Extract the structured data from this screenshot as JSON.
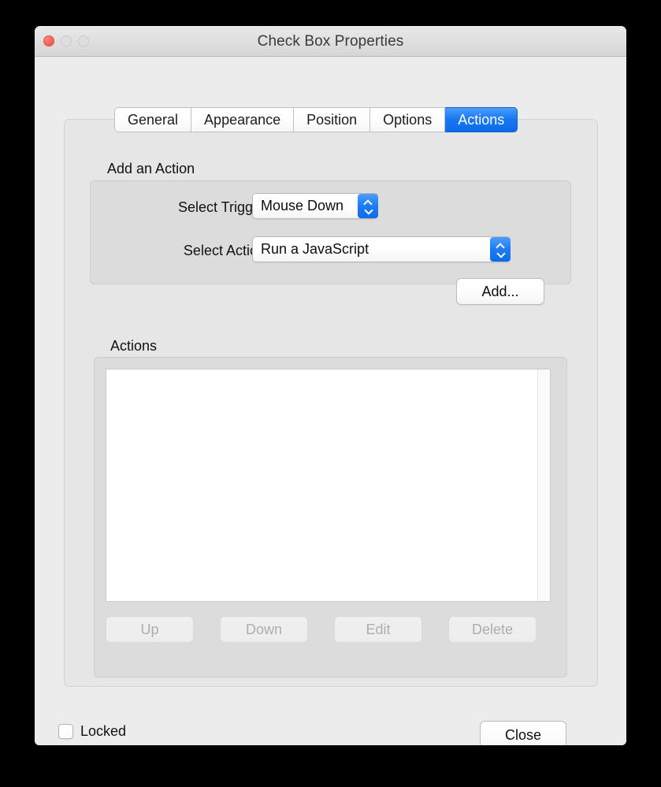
{
  "window": {
    "title": "Check Box Properties",
    "traffic_lights": [
      {
        "name": "close",
        "state": "active"
      },
      {
        "name": "minimize",
        "state": "disabled"
      },
      {
        "name": "zoom",
        "state": "disabled"
      }
    ]
  },
  "tabs": [
    {
      "label": "General",
      "selected": false
    },
    {
      "label": "Appearance",
      "selected": false
    },
    {
      "label": "Position",
      "selected": false
    },
    {
      "label": "Options",
      "selected": false
    },
    {
      "label": "Actions",
      "selected": true
    }
  ],
  "add_action_group": {
    "title": "Add an Action",
    "trigger": {
      "label": "Select Trigger:",
      "value": "Mouse Down"
    },
    "action": {
      "label": "Select Action:",
      "value": "Run a JavaScript"
    },
    "add_button": "Add..."
  },
  "actions_group": {
    "title": "Actions",
    "items": [],
    "buttons": [
      {
        "label": "Up",
        "enabled": false
      },
      {
        "label": "Down",
        "enabled": false
      },
      {
        "label": "Edit",
        "enabled": false
      },
      {
        "label": "Delete",
        "enabled": false
      }
    ]
  },
  "footer": {
    "locked_label": "Locked",
    "locked_checked": false,
    "close_button": "Close"
  },
  "colors": {
    "accent_blue": "#1878f2",
    "close_red": "#fc6258",
    "window_bg": "#ececec",
    "panel_bg": "#e6e6e6",
    "groupbox_bg": "#dcdcdc"
  }
}
